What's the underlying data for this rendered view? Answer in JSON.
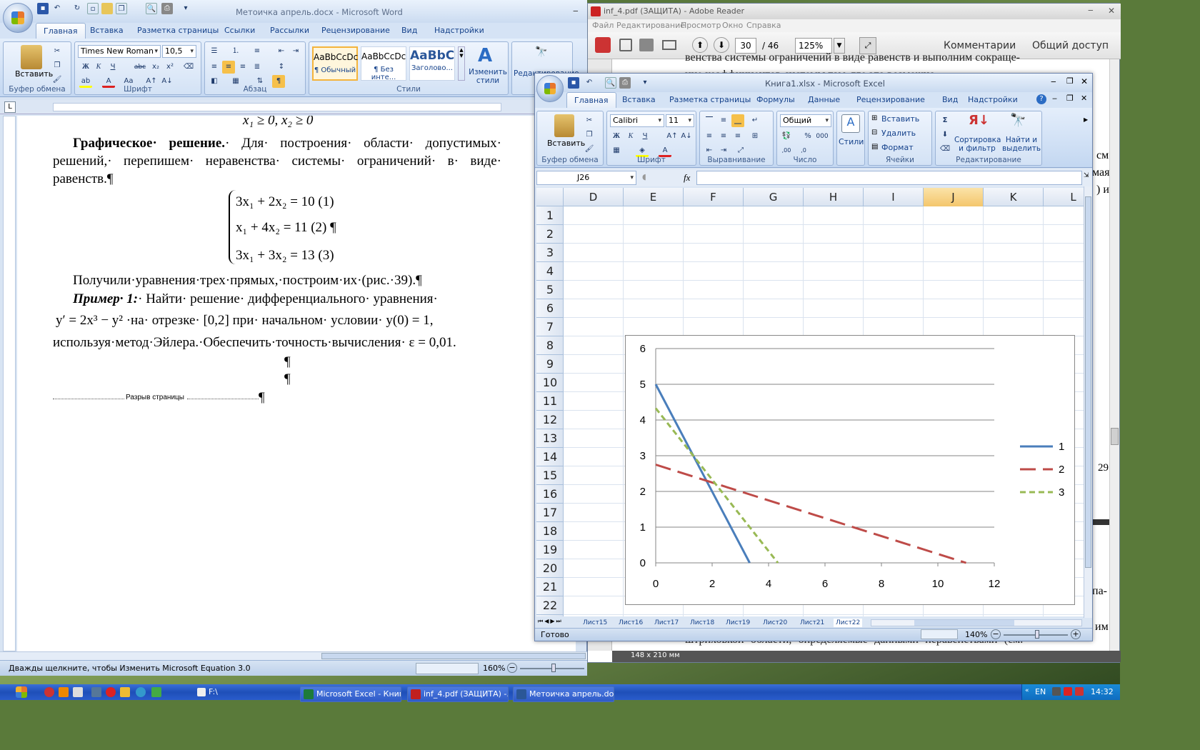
{
  "word": {
    "title": "Метoичка апрель.docx - Microsoft Word",
    "tabs": [
      "Главная",
      "Вставка",
      "Разметка страницы",
      "Ссылки",
      "Рассылки",
      "Рецензирование",
      "Вид",
      "Надстройки"
    ],
    "groups": {
      "clipboard": "Буфер обмена",
      "font": "Шрифт",
      "paragraph": "Абзац",
      "styles": "Стили",
      "editing": "Редактирование"
    },
    "paste_label": "Вставить",
    "font_name": "Times New Roman",
    "font_size": "10,5",
    "style_items": [
      {
        "preview": "AaBbCcDc",
        "name": "¶ Обычный"
      },
      {
        "preview": "AaBbCcDc",
        "name": "¶ Без инте..."
      },
      {
        "preview": "AaBbC",
        "name": "Заголово..."
      }
    ],
    "change_styles": "Изменить стили",
    "doc": {
      "top_line": "x₁ ≥ 0, x₂ ≥ 0",
      "heading_bold": "Графическое· решение.",
      "heading_rest": "· Для· построения· области· допустимых· решений,· перепишем· неравенства· системы· ограничений· в· виде· равенств.¶",
      "eq1": "3x₁ + 2x₂ = 10  (1)",
      "eq2": "x₁ + 4x₂ = 11    (2) ¶",
      "eq3": "3x₁ + 3x₂ = 13  (3)",
      "para2": "Получили·уравнения·трех·прямых,·построим·их·(рис.·39).¶",
      "example_bold": "Пример· 1:",
      "example_rest": "· Найти· решение· дифференциального· уравнения·",
      "line_eq": "y′ = 2x³ − y²   ·на· отрезке· [0,2] при· начальном· условии·  y(0) = 1,",
      "line_euler": "используя·метод·Эйлера.·Обеспечить·точность·вычисления· ε = 0,01.",
      "pilcrow": "¶",
      "page_break": "Разрыв страницы"
    },
    "status_left": "Дважды щелкните, чтобы Изменить Microsoft Equation 3.0",
    "zoom": "160%"
  },
  "reader": {
    "title": "inf_4.pdf (ЗАЩИТА) - Adobe Reader",
    "menu": [
      "Файл",
      "Редактирование",
      "Просмотр",
      "Окно",
      "Справка"
    ],
    "page_current": "30",
    "page_total": "/ 46",
    "zoom": "125%",
    "comments": "Комментарии",
    "share": "Общий доступ",
    "text_top1": "венства системы ограничений в виде равенств и выполним сокраще-",
    "text_top2": "ние коэффициентов системы там, где это возможно.",
    "text_bottom": "штриховкой· области,· определяемые· данными· неравенствами· (см.",
    "frag_1": "см",
    "frag_2": "мая",
    "frag_3": ") и",
    "frag_4": "29",
    "frag_5": "па-",
    "frag_6": "им",
    "page_size": "148 x 210 мм"
  },
  "excel": {
    "title": "Книга1.xlsx - Microsoft Excel",
    "tabs": [
      "Главная",
      "Вставка",
      "Разметка страницы",
      "Формулы",
      "Данные",
      "Рецензирование",
      "Вид",
      "Надстройки"
    ],
    "groups": {
      "clipboard": "Буфер обмена",
      "font": "Шрифт",
      "align": "Выравнивание",
      "number": "Число",
      "styles": "",
      "cells": "Ячейки",
      "editing": "Редактирование"
    },
    "paste_label": "Вставить",
    "font_name": "Calibri",
    "font_size": "11",
    "number_format": "Общий",
    "styles_label": "Стили",
    "cells_insert": "Вставить",
    "cells_delete": "Удалить",
    "cells_format": "Формат",
    "sort_label": "Сортировка и фильтр",
    "find_label": "Найти и выделить",
    "name_box": "J26",
    "fx": "fx",
    "columns": [
      "D",
      "E",
      "F",
      "G",
      "H",
      "I",
      "J",
      "K",
      "L"
    ],
    "rows": [
      "1",
      "2",
      "3",
      "4",
      "5",
      "6",
      "7",
      "8",
      "9",
      "10",
      "11",
      "12",
      "13",
      "14",
      "15",
      "16",
      "17",
      "18",
      "19",
      "20",
      "21",
      "22"
    ],
    "sheets": [
      "Лист15",
      "Лист16",
      "Лист17",
      "Лист18",
      "Лист19",
      "Лист20",
      "Лист21",
      "Лист22"
    ],
    "status": "Готово",
    "zoom": "140%"
  },
  "chart_data": {
    "type": "line",
    "title": "",
    "xlabel": "",
    "ylabel": "",
    "xlim": [
      0,
      12
    ],
    "ylim": [
      0,
      6
    ],
    "x_ticks": [
      "0",
      "2",
      "4",
      "6",
      "8",
      "10",
      "12"
    ],
    "y_ticks": [
      "0",
      "1",
      "2",
      "3",
      "4",
      "5",
      "6"
    ],
    "grid": "horizontal",
    "legend": "right",
    "series": [
      {
        "name": "1",
        "color": "#4a7ebb",
        "dash": "solid",
        "points": [
          [
            0,
            5
          ],
          [
            3.33,
            0
          ]
        ]
      },
      {
        "name": "2",
        "color": "#be4b48",
        "dash": "long-dash",
        "points": [
          [
            0,
            2.75
          ],
          [
            11,
            0
          ]
        ]
      },
      {
        "name": "3",
        "color": "#98b954",
        "dash": "short-dash",
        "points": [
          [
            0,
            4.33
          ],
          [
            4.33,
            0
          ]
        ]
      }
    ]
  },
  "taskbar": {
    "buttons": [
      {
        "label": "Microsoft Excel - Книг...",
        "color": "#1e7b3a"
      },
      {
        "label": "inf_4.pdf (ЗАЩИТА) -...",
        "color": "#c02020"
      },
      {
        "label": "Метoичка апрель.do...",
        "color": "#2b5797"
      }
    ],
    "folder": "F:\\",
    "lang": "EN",
    "time": "14:32"
  },
  "colors": {
    "ribbon_text": "#15428b",
    "desktop": "#5a7a3a"
  }
}
